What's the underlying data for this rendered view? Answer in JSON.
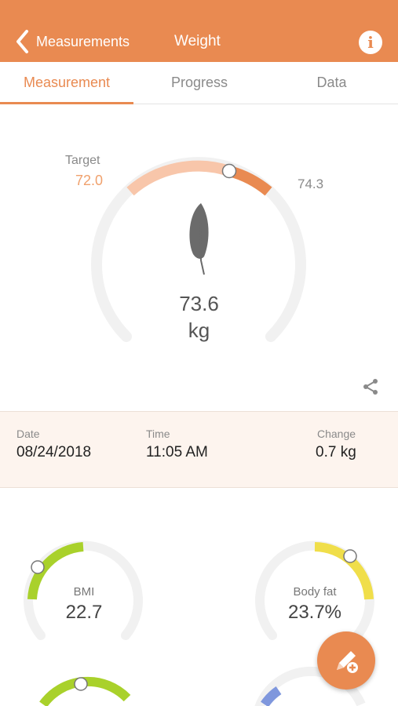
{
  "header": {
    "back_label": "Measurements",
    "title": "Weight",
    "background_color": "#e98a51",
    "back_icon": "chevron-left-icon",
    "info_icon": "info-icon"
  },
  "tabs": [
    {
      "label": "Measurement",
      "active": true
    },
    {
      "label": "Progress",
      "active": false
    },
    {
      "label": "Data",
      "active": false
    }
  ],
  "gauge": {
    "target_label": "Target",
    "target_value": "72.0",
    "max_value": "74.3",
    "weight": "73.6",
    "unit": "kg",
    "icon": "feather-icon",
    "target_color": "#f8c6aa",
    "accent_color": "#e98a51"
  },
  "share_icon": "share-icon",
  "info": {
    "date_label": "Date",
    "date_value": "08/24/2018",
    "time_label": "Time",
    "time_value": "11:05 AM",
    "change_label": "Change",
    "change_value": "0.7 kg"
  },
  "metrics": [
    {
      "label": "BMI",
      "value": "22.7",
      "color": "#a9d12b"
    },
    {
      "label": "Body fat",
      "value": "23.7%",
      "color": "#f0de4a"
    }
  ],
  "fab_icon": "edit-add-icon"
}
